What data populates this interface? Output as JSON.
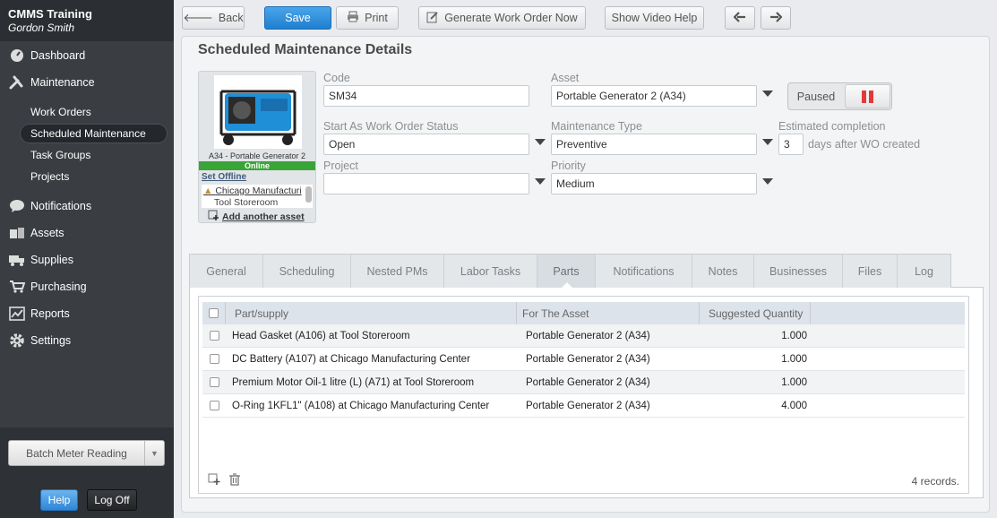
{
  "app": {
    "title": "CMMS Training",
    "user": "Gordon Smith"
  },
  "sidebar": {
    "items": [
      {
        "label": "Dashboard",
        "icon": "dashboard-icon"
      },
      {
        "label": "Maintenance",
        "icon": "tools-icon"
      },
      {
        "label": "Notifications",
        "icon": "chat-icon"
      },
      {
        "label": "Assets",
        "icon": "boxes-icon"
      },
      {
        "label": "Supplies",
        "icon": "truck-icon"
      },
      {
        "label": "Purchasing",
        "icon": "cart-icon"
      },
      {
        "label": "Reports",
        "icon": "chart-icon"
      },
      {
        "label": "Settings",
        "icon": "gear-icon"
      }
    ],
    "maintenance_sub": [
      "Work Orders",
      "Scheduled Maintenance",
      "Task Groups",
      "Projects"
    ],
    "active_sub": "Scheduled Maintenance",
    "batch_button": "Batch Meter Reading",
    "help": "Help",
    "logoff": "Log Off"
  },
  "toolbar": {
    "back": "Back",
    "save": "Save",
    "print": "Print",
    "generate": "Generate Work Order Now",
    "video": "Show Video Help"
  },
  "page": {
    "title": "Scheduled Maintenance Details"
  },
  "asset_card": {
    "name": "A34 - Portable Generator 2",
    "status": "Online",
    "set_offline": "Set Offline",
    "location1": "Chicago Manufacturi",
    "location2": "Tool Storeroom",
    "add_asset": "Add another asset"
  },
  "form": {
    "code_label": "Code",
    "code": "SM34",
    "asset_label": "Asset",
    "asset": "Portable Generator 2 (A34)",
    "status_label": "Start As Work Order Status",
    "status": "Open",
    "mtype_label": "Maintenance Type",
    "mtype": "Preventive",
    "est_label": "Estimated completion",
    "est_value": "3",
    "est_suffix": "days after WO created",
    "project_label": "Project",
    "project": "",
    "priority_label": "Priority",
    "priority": "Medium",
    "paused": "Paused"
  },
  "tabs": [
    "General",
    "Scheduling",
    "Nested PMs",
    "Labor Tasks",
    "Parts",
    "Notifications",
    "Notes",
    "Businesses",
    "Files",
    "Log"
  ],
  "active_tab": "Parts",
  "grid": {
    "headers": [
      "Part/supply",
      "For The Asset",
      "Suggested Quantity"
    ],
    "rows": [
      [
        "Head Gasket (A106) at Tool Storeroom",
        "Portable Generator 2 (A34)",
        "1.000"
      ],
      [
        "DC Battery (A107) at Chicago Manufacturing Center",
        "Portable Generator 2 (A34)",
        "1.000"
      ],
      [
        "Premium Motor Oil-1 litre (L) (A71) at Tool Storeroom",
        "Portable Generator 2 (A34)",
        "1.000"
      ],
      [
        "O-Ring 1KFL1\" (A108) at Chicago Manufacturing Center",
        "Portable Generator 2 (A34)",
        "4.000"
      ]
    ],
    "records": "4 records."
  }
}
